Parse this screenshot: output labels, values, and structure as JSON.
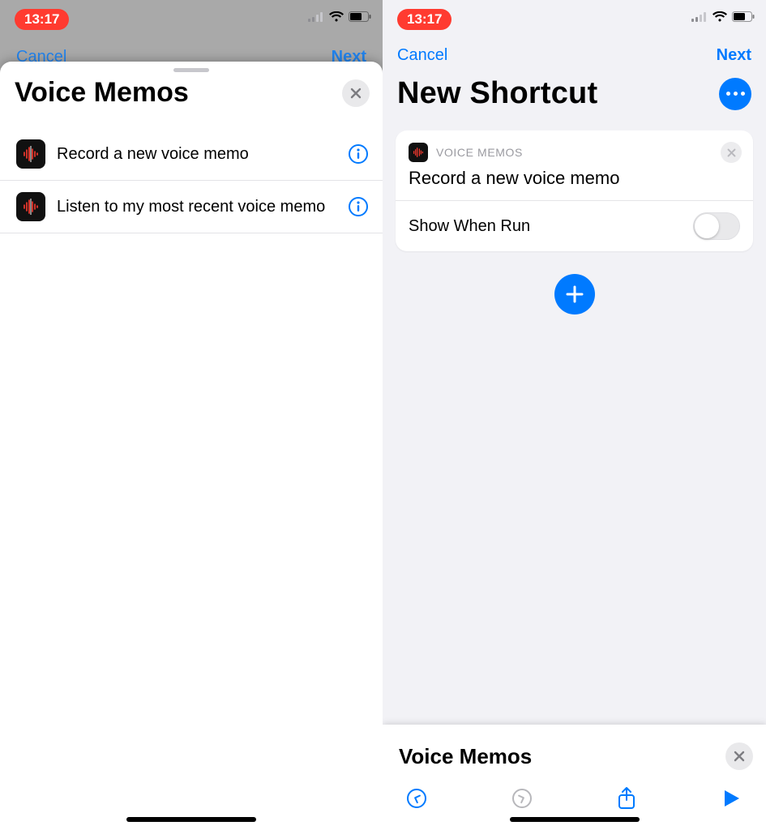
{
  "status": {
    "time": "13:17"
  },
  "left": {
    "occluded_cancel": "Cancel",
    "occluded_next": "Next",
    "sheet_title": "Voice Memos",
    "items": [
      {
        "label": "Record a new voice memo"
      },
      {
        "label": "Listen to my most recent voice memo"
      }
    ]
  },
  "right": {
    "cancel": "Cancel",
    "next": "Next",
    "title": "New Shortcut",
    "card": {
      "app_label": "VOICE MEMOS",
      "action": "Record a new voice memo",
      "toggle_label": "Show When Run",
      "toggle_on": false
    },
    "drawer_title": "Voice Memos"
  }
}
